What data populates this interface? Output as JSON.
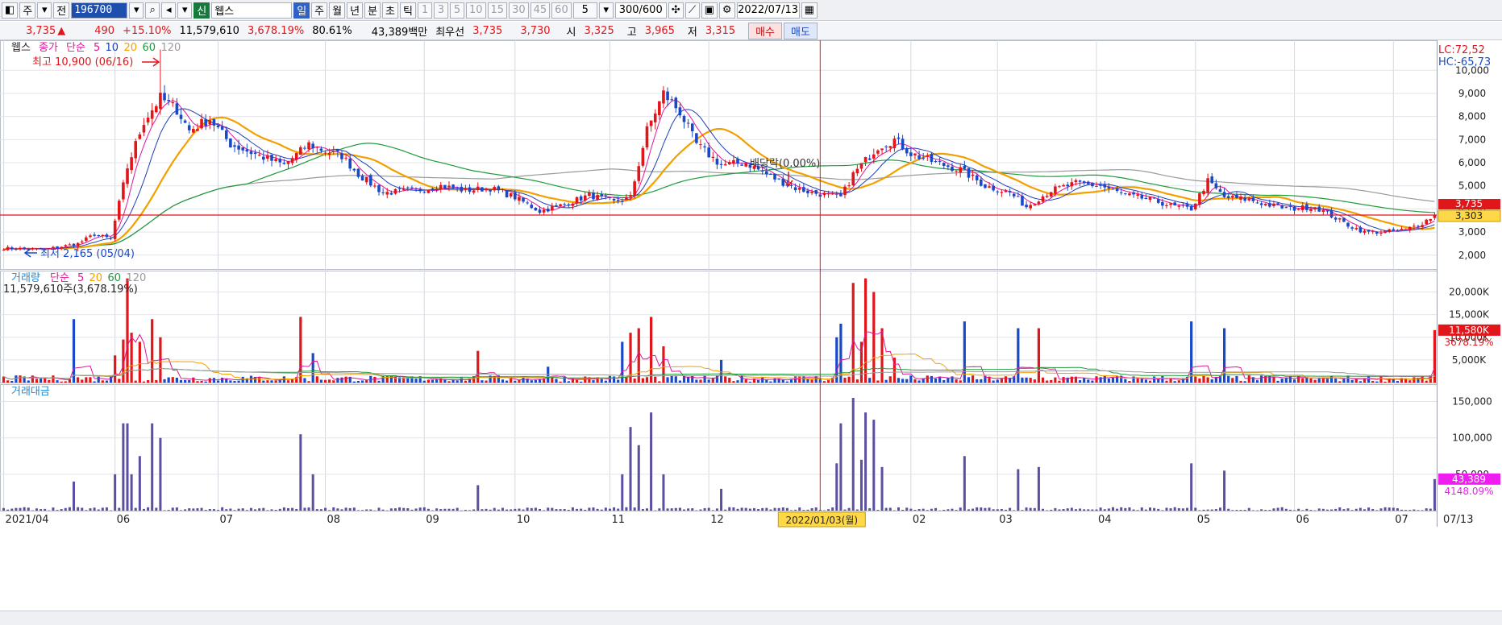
{
  "toolbar": {
    "market_kind": "주",
    "prev_label": "전",
    "code": "196700",
    "type_badge": "신",
    "name": "웹스",
    "periods": [
      "일",
      "주",
      "월",
      "년",
      "분",
      "초",
      "틱"
    ],
    "nums": [
      "1",
      "3",
      "5",
      "10",
      "15",
      "30",
      "45",
      "60"
    ],
    "interval": "5",
    "count": "300/600",
    "date": "2022/07/13"
  },
  "quote": {
    "price": "3,735",
    "change": "490",
    "change_pct": "+15.10%",
    "volume": "11,579,610",
    "volume_ratio": "3,678.19%",
    "turnover": "80.61%",
    "amount": "43,389백만",
    "best_label": "최우선",
    "best_ask": "3,735",
    "best_bid": "3,730",
    "open_label": "시",
    "open": "3,325",
    "high_label": "고",
    "high": "3,965",
    "low_label": "저",
    "low": "3,315",
    "buy_label": "매수",
    "sell_label": "매도"
  },
  "colors": {
    "up": "#e0161b",
    "down": "#1a49c8",
    "ma5": "#e0159a",
    "ma10": "#1f3fb8",
    "ma20": "#f2a000",
    "ma60": "#1e9a3c",
    "ma120": "#9a9a9a",
    "amount_bar": "#5a4fa0"
  },
  "chart_data": [
    {
      "type": "candlestick",
      "panel": "price",
      "legend": [
        "웹스",
        "종가",
        "단순",
        "5",
        "10",
        "20",
        "60",
        "120"
      ],
      "lc": "LC:72,52",
      "hc": "HC:-65,73",
      "ylim": [
        1400,
        11300
      ],
      "yticks": [
        2000,
        3000,
        4000,
        5000,
        6000,
        7000,
        8000,
        9000,
        10000
      ],
      "ytick_labels": [
        "2,000",
        "3,000",
        "4,000",
        "5,000",
        "6,000",
        "7,000",
        "8,000",
        "9,000",
        "10,000"
      ],
      "current_price": 3735,
      "current_label": "3,735",
      "marker_price": 3303,
      "marker_label": "3,303",
      "high_note": "최고 10,900 (06/16)",
      "low_note": "최저 2,165 (05/04)",
      "dividend_note": "배당락(0.00%)",
      "high_value": 10900,
      "low_value": 2165,
      "close_keys": [
        [
          0,
          2300
        ],
        [
          10,
          2250
        ],
        [
          18,
          2500
        ],
        [
          22,
          2900
        ],
        [
          26,
          2700
        ],
        [
          30,
          5800
        ],
        [
          34,
          7800
        ],
        [
          38,
          8800
        ],
        [
          42,
          8300
        ],
        [
          45,
          7400
        ],
        [
          50,
          7900
        ],
        [
          55,
          6800
        ],
        [
          62,
          6300
        ],
        [
          68,
          5900
        ],
        [
          74,
          6800
        ],
        [
          78,
          6500
        ],
        [
          82,
          6300
        ],
        [
          86,
          5500
        ],
        [
          92,
          4700
        ],
        [
          100,
          4800
        ],
        [
          106,
          5000
        ],
        [
          112,
          4800
        ],
        [
          118,
          4900
        ],
        [
          124,
          4500
        ],
        [
          130,
          3900
        ],
        [
          136,
          4200
        ],
        [
          142,
          4600
        ],
        [
          148,
          4300
        ],
        [
          152,
          4500
        ],
        [
          156,
          7400
        ],
        [
          160,
          9000
        ],
        [
          164,
          8200
        ],
        [
          168,
          6800
        ],
        [
          174,
          5900
        ],
        [
          180,
          6000
        ],
        [
          186,
          5400
        ],
        [
          192,
          4900
        ],
        [
          196,
          4700
        ],
        [
          200,
          4600
        ],
        [
          203,
          4500
        ],
        [
          206,
          5500
        ],
        [
          212,
          6700
        ],
        [
          216,
          7000
        ],
        [
          220,
          6400
        ],
        [
          226,
          6000
        ],
        [
          232,
          5700
        ],
        [
          238,
          5000
        ],
        [
          244,
          4700
        ],
        [
          248,
          4100
        ],
        [
          254,
          4800
        ],
        [
          260,
          5100
        ],
        [
          266,
          5000
        ],
        [
          272,
          4600
        ],
        [
          278,
          4400
        ],
        [
          284,
          4100
        ],
        [
          288,
          4000
        ],
        [
          292,
          5200
        ],
        [
          296,
          4500
        ],
        [
          302,
          4400
        ],
        [
          306,
          4200
        ],
        [
          312,
          4000
        ],
        [
          318,
          4100
        ],
        [
          322,
          3700
        ],
        [
          326,
          3300
        ],
        [
          330,
          3000
        ],
        [
          334,
          3000
        ],
        [
          340,
          3100
        ],
        [
          344,
          3400
        ],
        [
          347,
          3735
        ]
      ],
      "ma_periods": [
        5,
        10,
        20,
        60,
        120
      ]
    },
    {
      "type": "bar",
      "panel": "volume",
      "legend": [
        "거래량",
        "단순",
        "5",
        "20",
        "60",
        "120"
      ],
      "summary": "11,579,610주(3,678.19%)",
      "ylim": [
        0,
        24000
      ],
      "yticks": [
        5000,
        10000,
        15000,
        20000
      ],
      "ytick_labels": [
        "5,000K",
        "10,000K",
        "15,000K",
        "20,000K"
      ],
      "current_label": "11,580K",
      "ratio_label": "3678.19%",
      "spikes": [
        [
          17,
          14000
        ],
        [
          27,
          6000
        ],
        [
          29,
          9500
        ],
        [
          30,
          23000
        ],
        [
          31,
          11000
        ],
        [
          33,
          9000
        ],
        [
          36,
          14000
        ],
        [
          38,
          10000
        ],
        [
          72,
          14500
        ],
        [
          75,
          6500
        ],
        [
          115,
          7000
        ],
        [
          132,
          3500
        ],
        [
          150,
          9000
        ],
        [
          152,
          11000
        ],
        [
          154,
          12000
        ],
        [
          157,
          14500
        ],
        [
          160,
          8000
        ],
        [
          174,
          5000
        ],
        [
          202,
          10000
        ],
        [
          203,
          13000
        ],
        [
          206,
          22000
        ],
        [
          208,
          9000
        ],
        [
          209,
          23000
        ],
        [
          211,
          20000
        ],
        [
          213,
          12000
        ],
        [
          216,
          5500
        ],
        [
          233,
          13500
        ],
        [
          246,
          12000
        ],
        [
          251,
          12000
        ],
        [
          288,
          13500
        ],
        [
          296,
          12000
        ],
        [
          347,
          11580
        ]
      ]
    },
    {
      "type": "bar",
      "panel": "amount",
      "legend": [
        "거래대금"
      ],
      "ylim": [
        0,
        165000
      ],
      "yticks": [
        50000,
        100000,
        150000
      ],
      "ytick_labels": [
        "50,000",
        "100,000",
        "150,000"
      ],
      "current_label": "43,389",
      "ratio_label": "4148.09%",
      "spikes": [
        [
          17,
          40000
        ],
        [
          27,
          50000
        ],
        [
          29,
          120000
        ],
        [
          30,
          120000
        ],
        [
          31,
          50000
        ],
        [
          33,
          75000
        ],
        [
          36,
          120000
        ],
        [
          38,
          100000
        ],
        [
          72,
          105000
        ],
        [
          75,
          50000
        ],
        [
          115,
          35000
        ],
        [
          150,
          50000
        ],
        [
          152,
          115000
        ],
        [
          154,
          90000
        ],
        [
          157,
          135000
        ],
        [
          160,
          50000
        ],
        [
          174,
          30000
        ],
        [
          202,
          65000
        ],
        [
          203,
          120000
        ],
        [
          206,
          155000
        ],
        [
          208,
          70000
        ],
        [
          209,
          135000
        ],
        [
          211,
          125000
        ],
        [
          213,
          60000
        ],
        [
          233,
          75000
        ],
        [
          246,
          57000
        ],
        [
          251,
          60000
        ],
        [
          288,
          65000
        ],
        [
          296,
          55000
        ],
        [
          347,
          43389
        ]
      ]
    }
  ],
  "x_axis": {
    "months": [
      "2021/04",
      "06",
      "07",
      "08",
      "09",
      "10",
      "11",
      "12",
      "02",
      "03",
      "04",
      "05",
      "06",
      "07"
    ],
    "month_index": [
      0,
      27,
      52,
      78,
      102,
      124,
      147,
      171,
      220,
      241,
      265,
      289,
      313,
      337
    ],
    "cursor_index": 198,
    "cursor_label": "2022/01/03(월)",
    "end_label": "07/13"
  }
}
